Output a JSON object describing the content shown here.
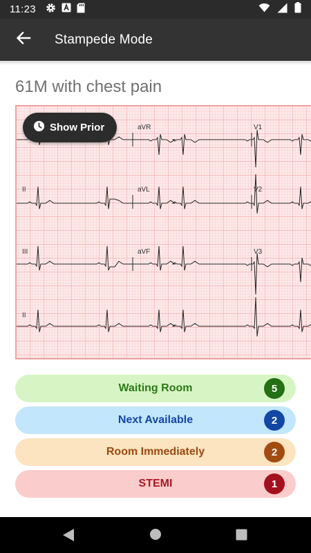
{
  "status_bar": {
    "time": "11:23",
    "left_icons": [
      "gear-icon",
      "font-icon",
      "sd-card-icon"
    ],
    "right_icons": [
      "wifi-icon",
      "signal-icon",
      "battery-icon"
    ]
  },
  "app_bar": {
    "title": "Stampede Mode",
    "back_icon": "arrow-left-icon"
  },
  "case": {
    "title": "61M with chest pain"
  },
  "ecg": {
    "lead_labels": [
      "aVR",
      "V1",
      "II",
      "aVL",
      "V2",
      "III",
      "aVF",
      "V3",
      "II"
    ],
    "show_prior_label": "Show Prior",
    "show_prior_icon": "clock-icon"
  },
  "triage": [
    {
      "label": "Waiting Room",
      "count": "5",
      "bg": "#d7f5c4",
      "fg": "#2c7a17",
      "badge": "#237015"
    },
    {
      "label": "Next Available",
      "count": "2",
      "bg": "#c2e6fb",
      "fg": "#1747a4",
      "badge": "#1347a4"
    },
    {
      "label": "Room Immediately",
      "count": "2",
      "bg": "#fbe4bf",
      "fg": "#9a4a12",
      "badge": "#a34c12"
    },
    {
      "label": "STEMI",
      "count": "1",
      "bg": "#fbcccc",
      "fg": "#a81a24",
      "badge": "#a3111f"
    }
  ],
  "nav_bar": {
    "icons": [
      "nav-back-icon",
      "nav-home-icon",
      "nav-recents-icon"
    ]
  },
  "colors": {
    "app_bar": "#333333",
    "status_bar": "#2b2b2b",
    "ecg_paper": "#fde9e9",
    "ecg_grid": "#f3a6a6"
  }
}
